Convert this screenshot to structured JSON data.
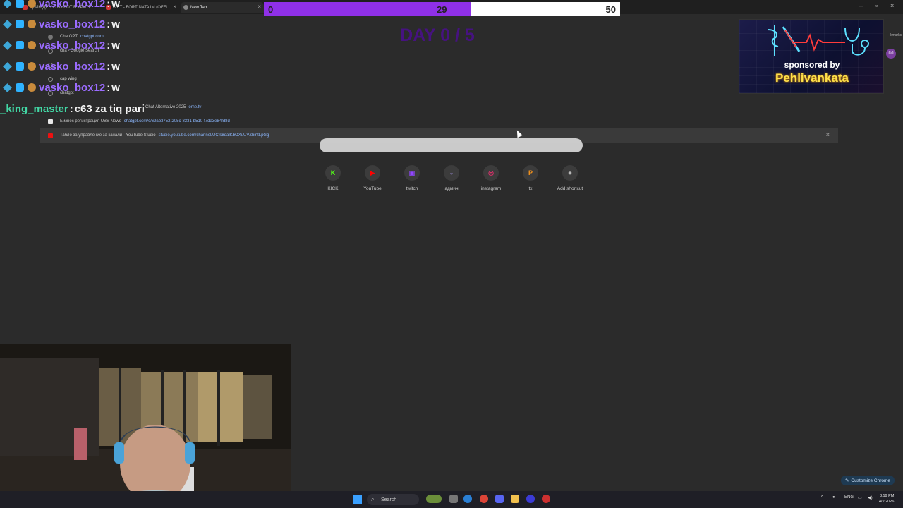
{
  "browser": {
    "tabs": [
      {
        "label": "ЕДИН ДЕН С ЖИВОТ В УРИТЕ",
        "active": false
      },
      {
        "label": "IVET - FORTINATA IM (OFFI",
        "active": false
      },
      {
        "label": "New Tab",
        "active": true
      }
    ],
    "bookmarks_label": "kmarks"
  },
  "goal_bar": {
    "min": "0",
    "current": "29",
    "max": "50",
    "progress": 0.58,
    "fill_color": "#8f30e8"
  },
  "day_counter": "DAY 0 / 5",
  "omnibox": {
    "suggestions": [
      {
        "title": "ChatGPT",
        "url": "chatgpt.com"
      },
      {
        "title": "cha - Google Search",
        "url": ""
      },
      {
        "title": "",
        "url": ""
      },
      {
        "title": "cap wing",
        "url": ""
      },
      {
        "title": "chatgpt",
        "url": ""
      },
      {
        "title": "Chat Alternative 2025",
        "url": "ome.tv"
      },
      {
        "title": "Бизнес регистрация UBS News",
        "url": "chatgpt.com/c/69ab3752-205c-8331-b510-f7da3e84fd8d"
      },
      {
        "title": "Табло за управление за канали - YouTube Studio",
        "url": "studio.youtube.com/channel/UCfs8qalKbOXuUVZbintLpGg"
      }
    ]
  },
  "shortcuts": [
    {
      "label": "KICK",
      "icon": "kick-icon",
      "glyph": "K",
      "color": "#53fc18"
    },
    {
      "label": "YouTube",
      "icon": "youtube-icon",
      "glyph": "▶",
      "color": "#ff0000"
    },
    {
      "label": "twitch",
      "icon": "twitch-icon",
      "glyph": "▣",
      "color": "#9146ff"
    },
    {
      "label": "админ",
      "icon": "admin-icon",
      "glyph": "◒",
      "color": "#8c7fbf"
    },
    {
      "label": "instagram",
      "icon": "instagram-icon",
      "glyph": "◎",
      "color": "#e1306c"
    },
    {
      "label": "tx",
      "icon": "tx-icon",
      "glyph": "P",
      "color": "#f7931a"
    },
    {
      "label": "Add shortcut",
      "icon": "plus-icon",
      "glyph": "+",
      "color": "#e0e0e0"
    }
  ],
  "chat": [
    {
      "user": "vasko_box12",
      "sep": ":",
      "msg": "w"
    },
    {
      "user": "vasko_box12",
      "sep": ":",
      "msg": "w"
    },
    {
      "user": "vasko_box12",
      "sep": ":",
      "msg": "w"
    },
    {
      "user": "vasko_box12",
      "sep": ":",
      "msg": "w"
    },
    {
      "user": "vasko_box12",
      "sep": ":",
      "msg": "w"
    },
    {
      "user": "_king_master",
      "sep": ":",
      "msg": "c63 za tiq pari"
    }
  ],
  "sponsor": {
    "line1": "sponsored by",
    "line2": "Pehlivankata"
  },
  "profile_initials": "DJ",
  "customize_label": "Customize Chrome",
  "taskbar": {
    "search_label": "Search",
    "lang": "ENG",
    "time": "8:19 PM",
    "date": "4/2/2026"
  }
}
